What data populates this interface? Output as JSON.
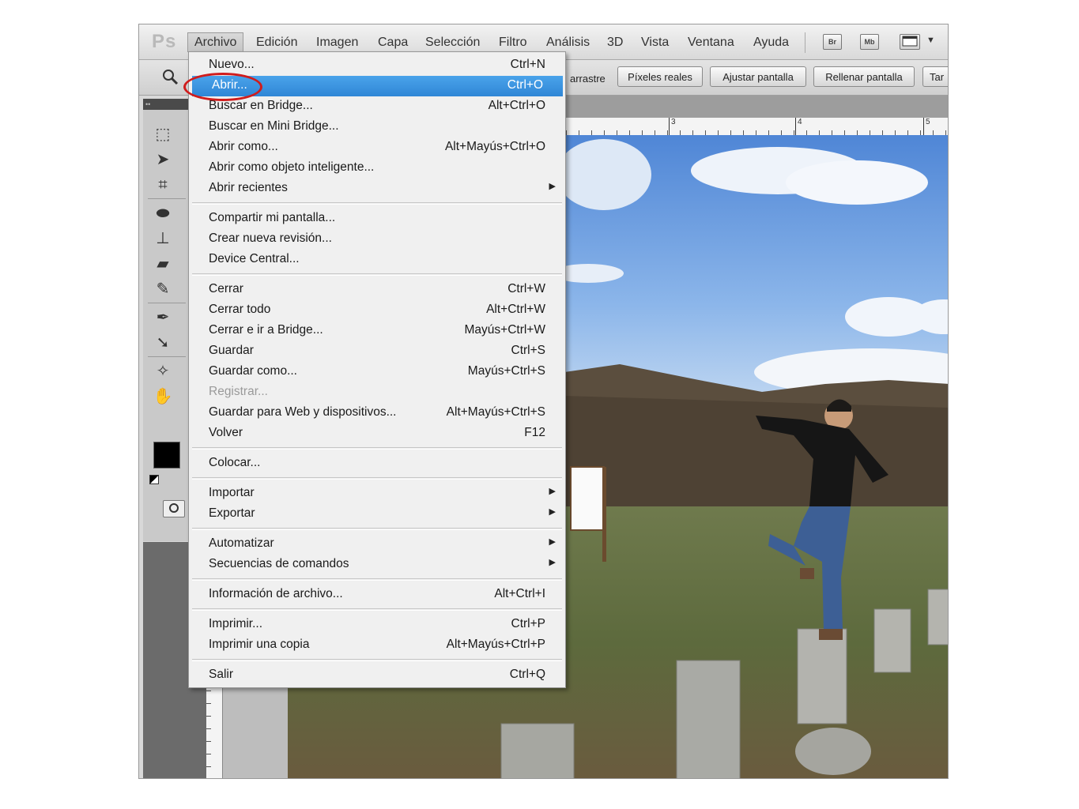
{
  "app": {
    "logo": "Ps",
    "menubar": [
      "Archivo",
      "Edición",
      "Imagen",
      "Capa",
      "Selección",
      "Filtro",
      "Análisis",
      "3D",
      "Vista",
      "Ventana",
      "Ayuda"
    ],
    "toolbar_icons": [
      {
        "icon": "bridge-icon",
        "label": "Br"
      },
      {
        "icon": "mini-bridge-icon",
        "label": "Mb"
      },
      {
        "icon": "screen-mode-icon",
        "label": ""
      }
    ]
  },
  "options_bar": {
    "zoom_tool_icon": "zoom-icon",
    "drag_text": "arrastre",
    "buttons": [
      "Píxeles reales",
      "Ajustar pantalla",
      "Rellenar pantalla",
      "Tar"
    ]
  },
  "ruler": {
    "labels": [
      "3",
      "4",
      "5"
    ]
  },
  "file_menu": {
    "title": "Archivo",
    "groups": [
      [
        {
          "label": "Nuevo...",
          "shortcut": "Ctrl+N"
        },
        {
          "label": "Abrir...",
          "shortcut": "Ctrl+O",
          "highlighted": true
        },
        {
          "label": "Buscar en Bridge...",
          "shortcut": "Alt+Ctrl+O"
        },
        {
          "label": "Buscar en Mini Bridge...",
          "shortcut": ""
        },
        {
          "label": "Abrir como...",
          "shortcut": "Alt+Mayús+Ctrl+O"
        },
        {
          "label": "Abrir como objeto inteligente...",
          "shortcut": ""
        },
        {
          "label": "Abrir recientes",
          "shortcut": "",
          "submenu": true
        }
      ],
      [
        {
          "label": "Compartir mi pantalla...",
          "shortcut": ""
        },
        {
          "label": "Crear nueva revisión...",
          "shortcut": ""
        },
        {
          "label": "Device Central...",
          "shortcut": ""
        }
      ],
      [
        {
          "label": "Cerrar",
          "shortcut": "Ctrl+W"
        },
        {
          "label": "Cerrar todo",
          "shortcut": "Alt+Ctrl+W"
        },
        {
          "label": "Cerrar e ir a Bridge...",
          "shortcut": "Mayús+Ctrl+W"
        },
        {
          "label": "Guardar",
          "shortcut": "Ctrl+S"
        },
        {
          "label": "Guardar como...",
          "shortcut": "Mayús+Ctrl+S"
        },
        {
          "label": "Registrar...",
          "shortcut": "",
          "disabled": true
        },
        {
          "label": "Guardar para Web y dispositivos...",
          "shortcut": "Alt+Mayús+Ctrl+S"
        },
        {
          "label": "Volver",
          "shortcut": "F12"
        }
      ],
      [
        {
          "label": "Colocar...",
          "shortcut": ""
        }
      ],
      [
        {
          "label": "Importar",
          "shortcut": "",
          "submenu": true
        },
        {
          "label": "Exportar",
          "shortcut": "",
          "submenu": true
        }
      ],
      [
        {
          "label": "Automatizar",
          "shortcut": "",
          "submenu": true
        },
        {
          "label": "Secuencias de comandos",
          "shortcut": "",
          "submenu": true
        }
      ],
      [
        {
          "label": "Información de archivo...",
          "shortcut": "Alt+Ctrl+I"
        }
      ],
      [
        {
          "label": "Imprimir...",
          "shortcut": "Ctrl+P"
        },
        {
          "label": "Imprimir una copia",
          "shortcut": "Alt+Mayús+Ctrl+P"
        }
      ],
      [
        {
          "label": "Salir",
          "shortcut": "Ctrl+Q"
        }
      ]
    ],
    "annotation": {
      "color": "#d01c1c",
      "target": "Abrir..."
    }
  },
  "colors": {
    "highlight": "#3a92df",
    "foreground_swatch": "#000000",
    "background_swatch": "#ffffff"
  }
}
